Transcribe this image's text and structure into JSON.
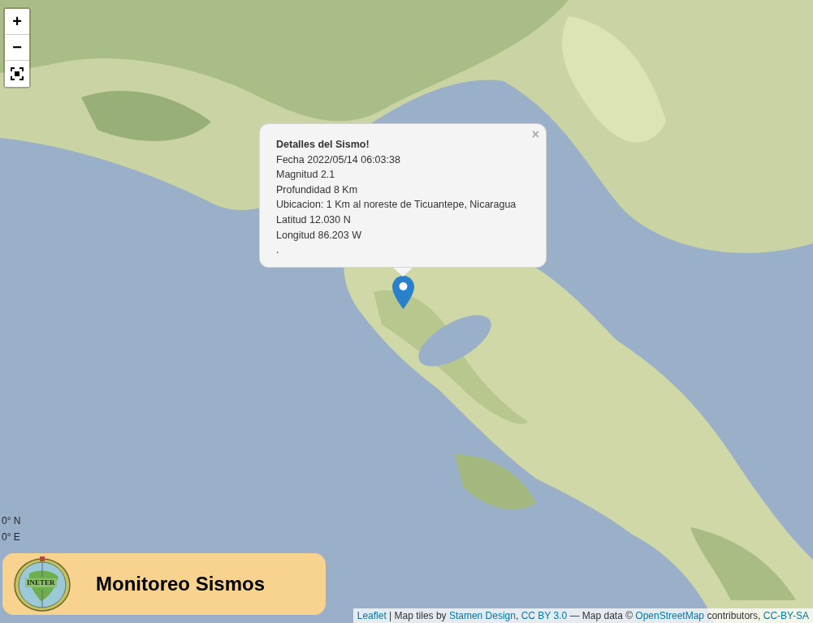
{
  "map": {
    "kind": "picture"
  },
  "zoom_controls": [
    {
      "kind": "zoom-in",
      "label": "+"
    },
    {
      "kind": "zoom-out",
      "label": "−"
    },
    {
      "kind": "fullscreen"
    }
  ],
  "popup": {
    "close": "×",
    "title": "Detalles del Sismo!",
    "lines": [
      "Fecha 2022/05/14 06:03:38",
      "Magnitud 2.1",
      "Profundidad 8 Km",
      "Ubicacion: 1 Km al noreste de Ticuantepe, Nicaragua",
      "Latitud 12.030 N",
      "Longitud 86.203 W",
      "."
    ]
  },
  "coordinates": [
    "0° N",
    "0° E"
  ],
  "banner": {
    "logo_text": "INETER",
    "title": "Monitoreo Sismos"
  },
  "attribution": [
    {
      "kind": "link",
      "text": "Leaflet"
    },
    {
      "kind": "text",
      "text": " | Map tiles by "
    },
    {
      "kind": "link",
      "text": "Stamen Design"
    },
    {
      "kind": "text",
      "text": ", "
    },
    {
      "kind": "link",
      "text": "CC BY 3.0"
    },
    {
      "kind": "text",
      "text": " — Map data © "
    },
    {
      "kind": "link",
      "text": "OpenStreetMap"
    },
    {
      "kind": "text",
      "text": " contributors, "
    },
    {
      "kind": "link",
      "text": "CC-BY-SA"
    }
  ]
}
